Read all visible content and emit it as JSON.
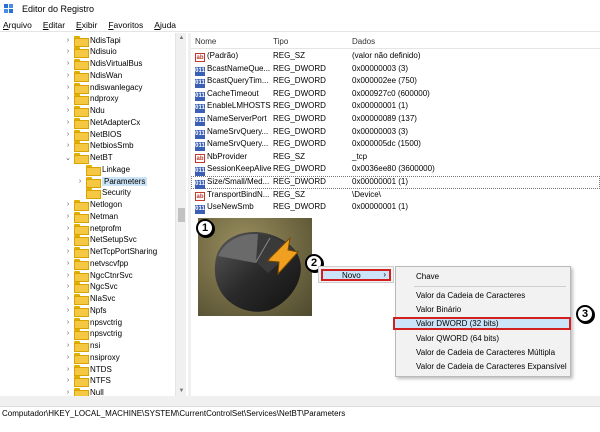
{
  "window": {
    "title": "Editor do Registro"
  },
  "menu": [
    {
      "label": "Arquivo",
      "u": "A",
      "rest": "rquivo"
    },
    {
      "label": "Editar",
      "u": "E",
      "rest": "ditar"
    },
    {
      "label": "Exibir",
      "u": "E",
      "rest": "xibir"
    },
    {
      "label": "Favoritos",
      "u": "F",
      "rest": "avoritos"
    },
    {
      "label": "Ajuda",
      "u": "A",
      "rest": "juda"
    }
  ],
  "tree": [
    {
      "label": "NdisTapi",
      "chev": "›",
      "indent": 0
    },
    {
      "label": "Ndisuio",
      "chev": "›",
      "indent": 0
    },
    {
      "label": "NdisVirtualBus",
      "chev": "›",
      "indent": 0
    },
    {
      "label": "NdisWan",
      "chev": "›",
      "indent": 0
    },
    {
      "label": "ndiswanlegacy",
      "chev": "›",
      "indent": 0
    },
    {
      "label": "ndproxy",
      "chev": "›",
      "indent": 0
    },
    {
      "label": "Ndu",
      "chev": "›",
      "indent": 0
    },
    {
      "label": "NetAdapterCx",
      "chev": "›",
      "indent": 0
    },
    {
      "label": "NetBIOS",
      "chev": "›",
      "indent": 0
    },
    {
      "label": "NetbiosSmb",
      "chev": "›",
      "indent": 0
    },
    {
      "label": "NetBT",
      "chev": "⌄",
      "indent": 0
    },
    {
      "label": "Linkage",
      "chev": "",
      "indent": 1
    },
    {
      "label": "Parameters",
      "chev": "›",
      "indent": 1,
      "selected": true
    },
    {
      "label": "Security",
      "chev": "",
      "indent": 1
    },
    {
      "label": "Netlogon",
      "chev": "›",
      "indent": 0
    },
    {
      "label": "Netman",
      "chev": "›",
      "indent": 0
    },
    {
      "label": "netprofm",
      "chev": "›",
      "indent": 0
    },
    {
      "label": "NetSetupSvc",
      "chev": "›",
      "indent": 0
    },
    {
      "label": "NetTcpPortSharing",
      "chev": "›",
      "indent": 0
    },
    {
      "label": "netvscvfpp",
      "chev": "›",
      "indent": 0
    },
    {
      "label": "NgcCtnrSvc",
      "chev": "›",
      "indent": 0
    },
    {
      "label": "NgcSvc",
      "chev": "›",
      "indent": 0
    },
    {
      "label": "NlaSvc",
      "chev": "›",
      "indent": 0
    },
    {
      "label": "Npfs",
      "chev": "›",
      "indent": 0
    },
    {
      "label": "npsvctrig",
      "chev": "›",
      "indent": 0
    },
    {
      "label": "npsvctrig",
      "chev": "›",
      "indent": 0
    },
    {
      "label": "nsi",
      "chev": "›",
      "indent": 0
    },
    {
      "label": "nsiproxy",
      "chev": "›",
      "indent": 0
    },
    {
      "label": "NTDS",
      "chev": "›",
      "indent": 0
    },
    {
      "label": "NTFS",
      "chev": "›",
      "indent": 0
    },
    {
      "label": "Null",
      "chev": "›",
      "indent": 0
    }
  ],
  "list": {
    "headers": {
      "name": "Nome",
      "type": "Tipo",
      "data": "Dados"
    },
    "rows": [
      {
        "icon": "sz",
        "name": "(Padrão)",
        "type": "REG_SZ",
        "data": "(valor não definido)"
      },
      {
        "icon": "dword",
        "name": "BcastNameQue...",
        "type": "REG_DWORD",
        "data": "0x00000003 (3)"
      },
      {
        "icon": "dword",
        "name": "BcastQueryTim...",
        "type": "REG_DWORD",
        "data": "0x000002ee (750)"
      },
      {
        "icon": "dword",
        "name": "CacheTimeout",
        "type": "REG_DWORD",
        "data": "0x000927c0 (600000)"
      },
      {
        "icon": "dword",
        "name": "EnableLMHOSTS",
        "type": "REG_DWORD",
        "data": "0x00000001 (1)"
      },
      {
        "icon": "dword",
        "name": "NameServerPort",
        "type": "REG_DWORD",
        "data": "0x00000089 (137)"
      },
      {
        "icon": "dword",
        "name": "NameSrvQuery...",
        "type": "REG_DWORD",
        "data": "0x00000003 (3)"
      },
      {
        "icon": "dword",
        "name": "NameSrvQuery...",
        "type": "REG_DWORD",
        "data": "0x000005dc (1500)"
      },
      {
        "icon": "sz",
        "name": "NbProvider",
        "type": "REG_SZ",
        "data": "_tcp"
      },
      {
        "icon": "dword",
        "name": "SessionKeepAlive",
        "type": "REG_DWORD",
        "data": "0x0036ee80 (3600000)"
      },
      {
        "icon": "dword",
        "name": "Size/Small/Med...",
        "type": "REG_DWORD",
        "data": "0x00000001 (1)",
        "selected": true
      },
      {
        "icon": "sz",
        "name": "TransportBindN...",
        "type": "REG_SZ",
        "data": "\\Device\\"
      },
      {
        "icon": "dword",
        "name": "UseNewSmb",
        "type": "REG_DWORD",
        "data": "0x00000001 (1)"
      }
    ]
  },
  "badges": {
    "one": "1",
    "two": "2",
    "three": "3"
  },
  "context_menu": {
    "novo": "Novo",
    "novo_arrow": "›",
    "items": {
      "chave": "Chave",
      "cadeia": "Valor da Cadeia de Caracteres",
      "binario": "Valor Binário",
      "dword": "Valor DWORD (32 bits)",
      "qword": "Valor QWORD (64 bits)",
      "multipla": "Valor de Cadeia de Caracteres Múltipla",
      "expansivel": "Valor de Cadeia de Caracteres Expansível"
    }
  },
  "status": {
    "path": "Computador\\HKEY_LOCAL_MACHINE\\SYSTEM\\CurrentControlSet\\Services\\NetBT\\Parameters"
  },
  "colors": {
    "highlight": "#cce4f7",
    "annotation_red": "#d21f1f",
    "folder": "#f4c842"
  }
}
